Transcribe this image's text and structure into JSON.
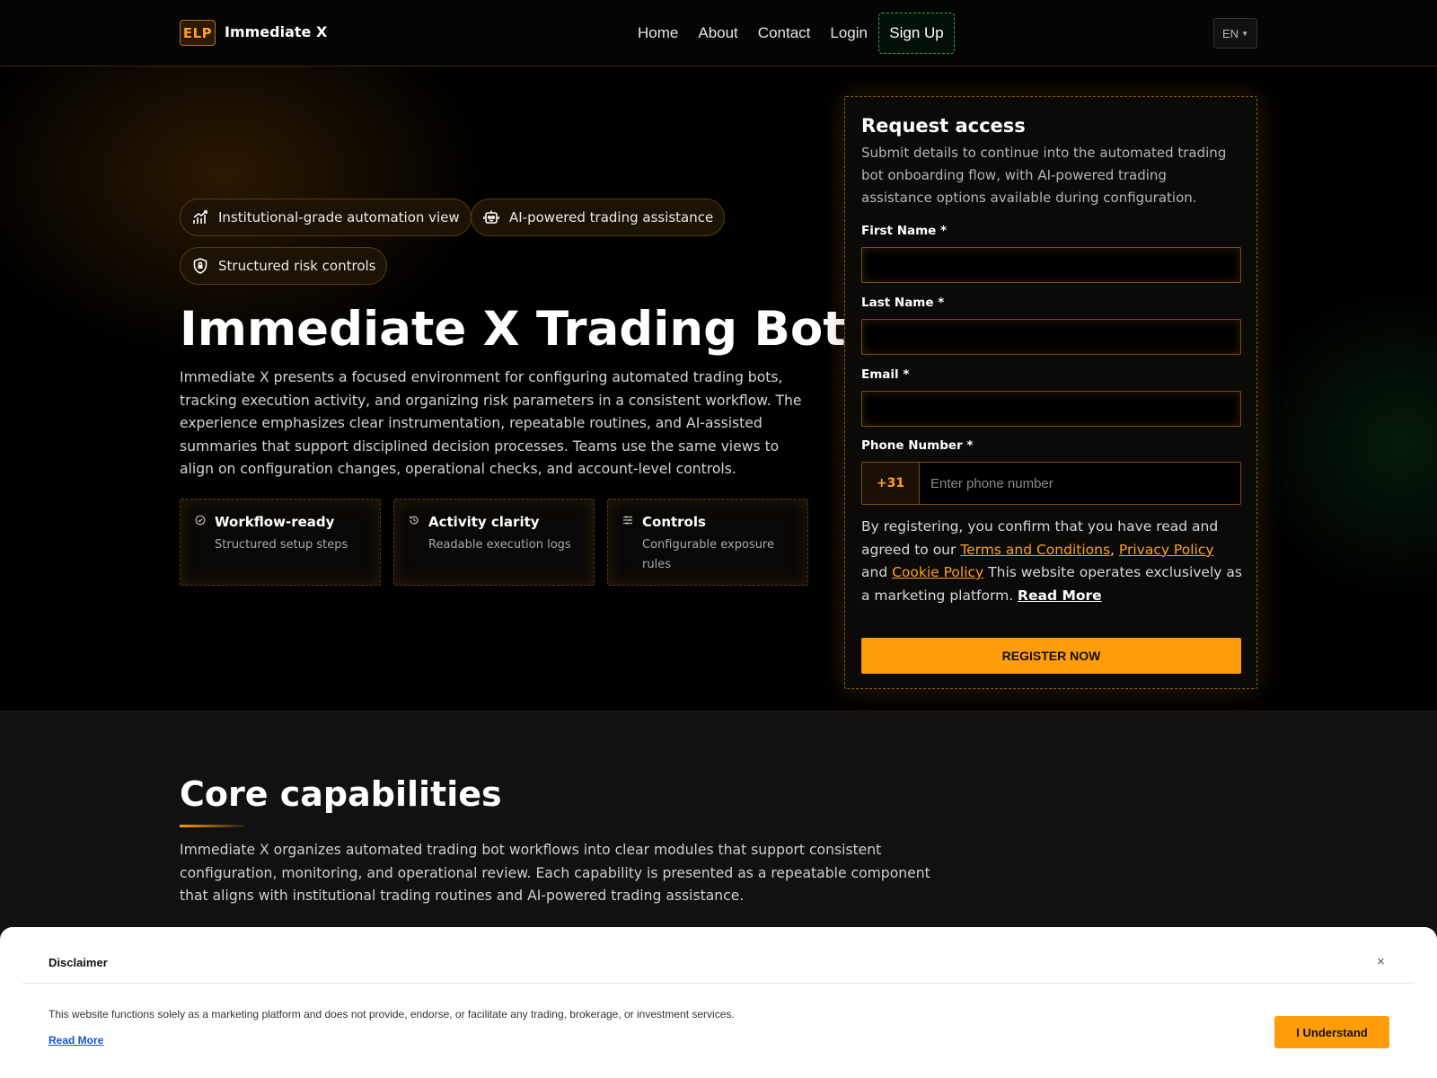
{
  "nav": {
    "logo_badge": "ELP",
    "brand": "Immediate X",
    "links": [
      "Home",
      "About",
      "Contact",
      "Login"
    ],
    "signup": "Sign Up",
    "language": "EN"
  },
  "hero": {
    "pills": [
      {
        "label": "Institutional-grade automation view",
        "icon": "chart-bars-icon"
      },
      {
        "label": "AI-powered trading assistance",
        "icon": "robot-icon"
      },
      {
        "label": "Structured risk controls",
        "icon": "shield-lock-icon"
      }
    ],
    "title": "Immediate X Trading Bots",
    "description": "Immediate X presents a focused environment for configuring automated trading bots, tracking execution activity, and organizing risk parameters in a consistent workflow. The experience emphasizes clear instrumentation, repeatable routines, and AI-assisted summaries that support disciplined decision processes. Teams use the same views to align on configuration changes, operational checks, and account-level controls.",
    "features": [
      {
        "title": "Workflow-ready",
        "desc": "Structured setup steps",
        "icon": "check-circle-icon"
      },
      {
        "title": "Activity clarity",
        "desc": "Readable execution logs",
        "icon": "history-icon"
      },
      {
        "title": "Controls",
        "desc": "Configurable exposure rules",
        "icon": "sliders-icon"
      }
    ]
  },
  "form": {
    "title": "Request access",
    "subtitle": "Submit details to continue into the automated trading bot onboarding flow, with AI-powered trading assistance options available during configuration.",
    "first_name_label": "First Name *",
    "last_name_label": "Last Name *",
    "email_label": "Email *",
    "phone_label": "Phone Number *",
    "phone_code": "+31",
    "phone_placeholder": "Enter phone number",
    "consent_prefix": "By registering, you confirm that you have read and agreed to our ",
    "terms": "Terms and Conditions",
    "comma": ",",
    "privacy": "Privacy Policy",
    "and": " and ",
    "cookie": "Cookie Policy",
    "consent_suffix": " This website operates exclusively as a marketing platform. ",
    "read_more": "Read More",
    "register": "REGISTER NOW"
  },
  "core": {
    "title": "Core capabilities",
    "description": "Immediate X organizes automated trading bot workflows into clear modules that support consistent configuration, monitoring, and operational review. Each capability is presented as a repeatable component that aligns with institutional trading routines and AI-powered trading assistance."
  },
  "disclaimer": {
    "title": "Disclaimer",
    "close": "×",
    "text": "This website functions solely as a marketing platform and does not provide, endorse, or facilitate any trading, brokerage, or investment services.",
    "read_more": "Read More",
    "button": "I Understand"
  },
  "colors": {
    "accent": "#ff9c0a",
    "signup_border": "#2fa845",
    "background": "#000000",
    "section_bg": "#111113"
  }
}
